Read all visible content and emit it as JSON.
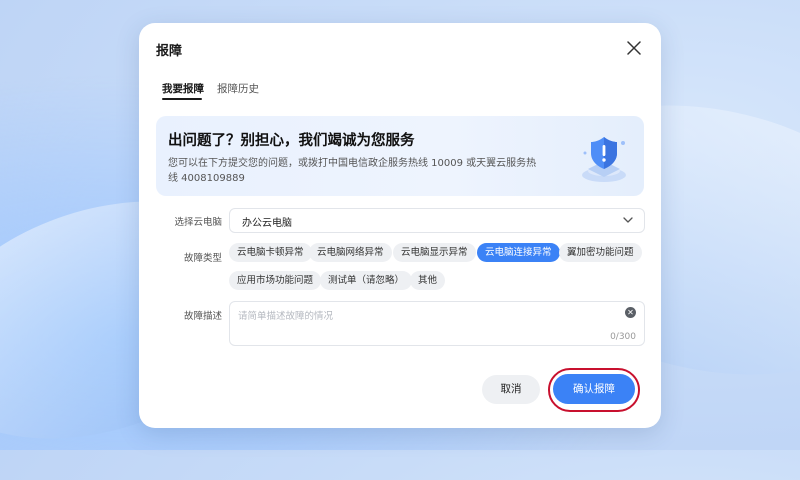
{
  "dialog": {
    "title": "报障"
  },
  "tabs": [
    {
      "label": "我要报障",
      "active": true
    },
    {
      "label": "报障历史",
      "active": false
    }
  ],
  "banner": {
    "title": "出问题了？别担心，我们竭诚为您服务",
    "text": "您可以在下方提交您的问题，或拨打中国电信政企服务热线 10009 或天翼云服务热线 4008109889"
  },
  "form": {
    "pc_label": "选择云电脑",
    "pc_value": "办公云电脑",
    "type_label": "故障类型",
    "types": [
      {
        "label": "云电脑卡顿异常",
        "selected": false
      },
      {
        "label": "云电脑网络异常",
        "selected": false
      },
      {
        "label": "云电脑显示异常",
        "selected": false
      },
      {
        "label": "云电脑连接异常",
        "selected": true
      },
      {
        "label": "翼加密功能问题",
        "selected": false
      },
      {
        "label": "应用市场功能问题",
        "selected": false
      },
      {
        "label": "测试单（请忽略）",
        "selected": false
      },
      {
        "label": "其他",
        "selected": false
      }
    ],
    "desc_label": "故障描述",
    "desc_placeholder": "请简单描述故障的情况",
    "desc_counter": "0/300"
  },
  "buttons": {
    "cancel": "取消",
    "confirm": "确认报障"
  },
  "colors": {
    "accent": "#3b82f6",
    "highlight_outline": "#c8102e"
  }
}
